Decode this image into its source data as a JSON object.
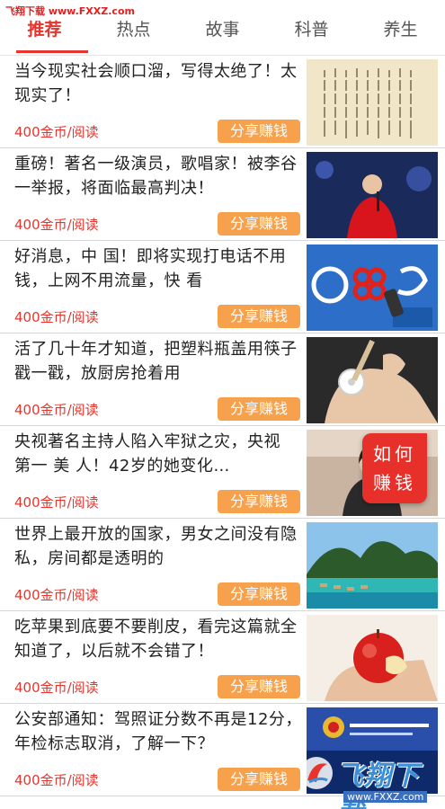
{
  "watermark_top": "飞翔下载 www.FXXZ.com",
  "tabs": [
    {
      "label": "推荐",
      "active": true
    },
    {
      "label": "热点",
      "active": false
    },
    {
      "label": "故事",
      "active": false
    },
    {
      "label": "科普",
      "active": false
    },
    {
      "label": "养生",
      "active": false
    }
  ],
  "articles": [
    {
      "title": "当今现实社会顺口溜，写得太绝了！太现实了！",
      "price": "400金币/阅读",
      "share": "分享赚钱",
      "thumb": "calligraphy-image"
    },
    {
      "title": "重磅！著名一级演员，歌唱家！被李谷一举报，将面临最高判决！",
      "price": "400金币/阅读",
      "share": "分享赚钱",
      "thumb": "singer-red-dress-image"
    },
    {
      "title": "好消息，中 国！即将实现打电话不用钱，上网不用流量，快 看",
      "price": "400金币/阅读",
      "share": "分享赚钱",
      "thumb": "telecom-logos-image"
    },
    {
      "title": "活了几十年才知道，把塑料瓶盖用筷子戳一戳，放厨房抢着用",
      "price": "400金币/阅读",
      "share": "分享赚钱",
      "thumb": "bottle-cap-hand-image"
    },
    {
      "title": "央视著名主持人陷入牢狱之灾，央视 第一 美 人！42岁的她变化…",
      "price": "400金币/阅读",
      "share": "分享赚钱",
      "thumb": "host-portrait-image"
    },
    {
      "title": "世界上最开放的国家，男女之间没有隐私，房间都是透明的",
      "price": "400金币/阅读",
      "share": "分享赚钱",
      "thumb": "island-landscape-image"
    },
    {
      "title": "吃苹果到底要不要削皮，看完这篇就全知道了，以后就不会错了！",
      "price": "400金币/阅读",
      "share": "分享赚钱",
      "thumb": "apple-image"
    },
    {
      "title": "公安部通知：驾照证分数不再是12分，年检标志取消，了解一下？",
      "price": "400金币/阅读",
      "share": "分享赚钱",
      "thumb": "press-conference-image"
    }
  ],
  "float_badge": {
    "line1": "如何",
    "line2": "赚钱"
  },
  "watermark_bottom": {
    "logo": "飞翔下载",
    "url": "www.FXXZ.com"
  },
  "colors": {
    "accent": "#e8342c",
    "share_button": "#f7a14c"
  }
}
